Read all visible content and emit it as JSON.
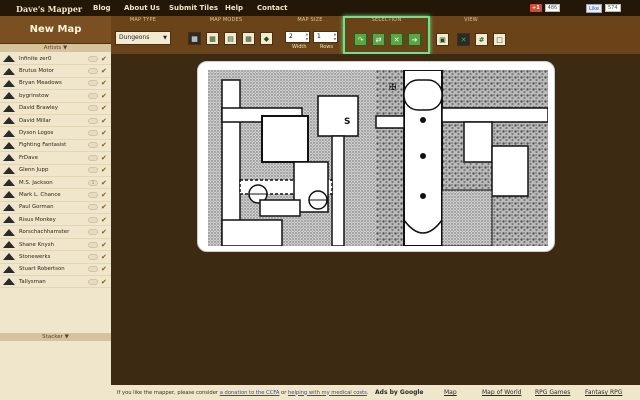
{
  "nav": {
    "brand": "Dave's Mapper",
    "items": [
      "Blog",
      "About Us",
      "Submit Tiles",
      "Help",
      "Contact"
    ],
    "gplus_label": "+1",
    "gplus_count": "486",
    "fb_label": "Like",
    "fb_count": "574"
  },
  "sidebar": {
    "new_map": "New Map",
    "artists_header": "Artists ▼",
    "stacker_header": "Stacker ▼",
    "artists": [
      {
        "name": "Infinite zer0",
        "toggle": "",
        "checked": "✔"
      },
      {
        "name": "Brutus Motor",
        "toggle": "",
        "checked": "✔"
      },
      {
        "name": "Bryan Meadows",
        "toggle": "",
        "checked": "✔"
      },
      {
        "name": "bygrinstow",
        "toggle": "",
        "checked": "✔"
      },
      {
        "name": "David Brawley",
        "toggle": "",
        "checked": "✔"
      },
      {
        "name": "David Millar",
        "toggle": "",
        "checked": "✔"
      },
      {
        "name": "Dyson Logos",
        "toggle": "",
        "checked": "✔"
      },
      {
        "name": "Fighting Fantasist",
        "toggle": "",
        "checked": "✔"
      },
      {
        "name": "FrDave",
        "toggle": "",
        "checked": "✔"
      },
      {
        "name": "Glenn Jupp",
        "toggle": "",
        "checked": "✔"
      },
      {
        "name": "M.S. Jackson",
        "toggle": "1",
        "checked": "✔"
      },
      {
        "name": "Mark L. Chance",
        "toggle": "",
        "checked": "✔"
      },
      {
        "name": "Paul Gorman",
        "toggle": "",
        "checked": "✔"
      },
      {
        "name": "Risus Monkey",
        "toggle": "",
        "checked": "✔"
      },
      {
        "name": "Rorschachhamster",
        "toggle": "",
        "checked": "✔"
      },
      {
        "name": "Shane Knysh",
        "toggle": "",
        "checked": "✔"
      },
      {
        "name": "Stonewerks",
        "toggle": "",
        "checked": "✔"
      },
      {
        "name": "Stuart Robertson",
        "toggle": "",
        "checked": "✔"
      },
      {
        "name": "Tallysman",
        "toggle": "",
        "checked": "✔"
      }
    ]
  },
  "toolbar": {
    "map_type_label": "MAP TYPE",
    "map_type_value": "Dungeons",
    "map_modes_label": "MAP MODES",
    "map_size_label": "MAP SIZE",
    "width_value": "2",
    "rows_value": "1",
    "width_label": "Width",
    "rows_label": "Rows",
    "selection_label": "SELECTION",
    "view_label": "VIEW"
  },
  "footer": {
    "message_prefix": "If you like the mapper, please consider ",
    "donation_link": "a donation to the CCFA",
    "message_mid": " or ",
    "medical_link": "helping with my medical costs",
    "message_suffix": ".",
    "ads": "Ads by Google",
    "links": [
      "Map",
      "Map of World",
      "RPG Games",
      "Fantasy RPG"
    ]
  },
  "colors": {
    "nav_bg": "#231708",
    "toolbar_bg": "#6a4418",
    "canvas_bg": "#3c2a12",
    "sidebar_bg": "#efe6cc",
    "selection_highlight": "#72e08a"
  }
}
